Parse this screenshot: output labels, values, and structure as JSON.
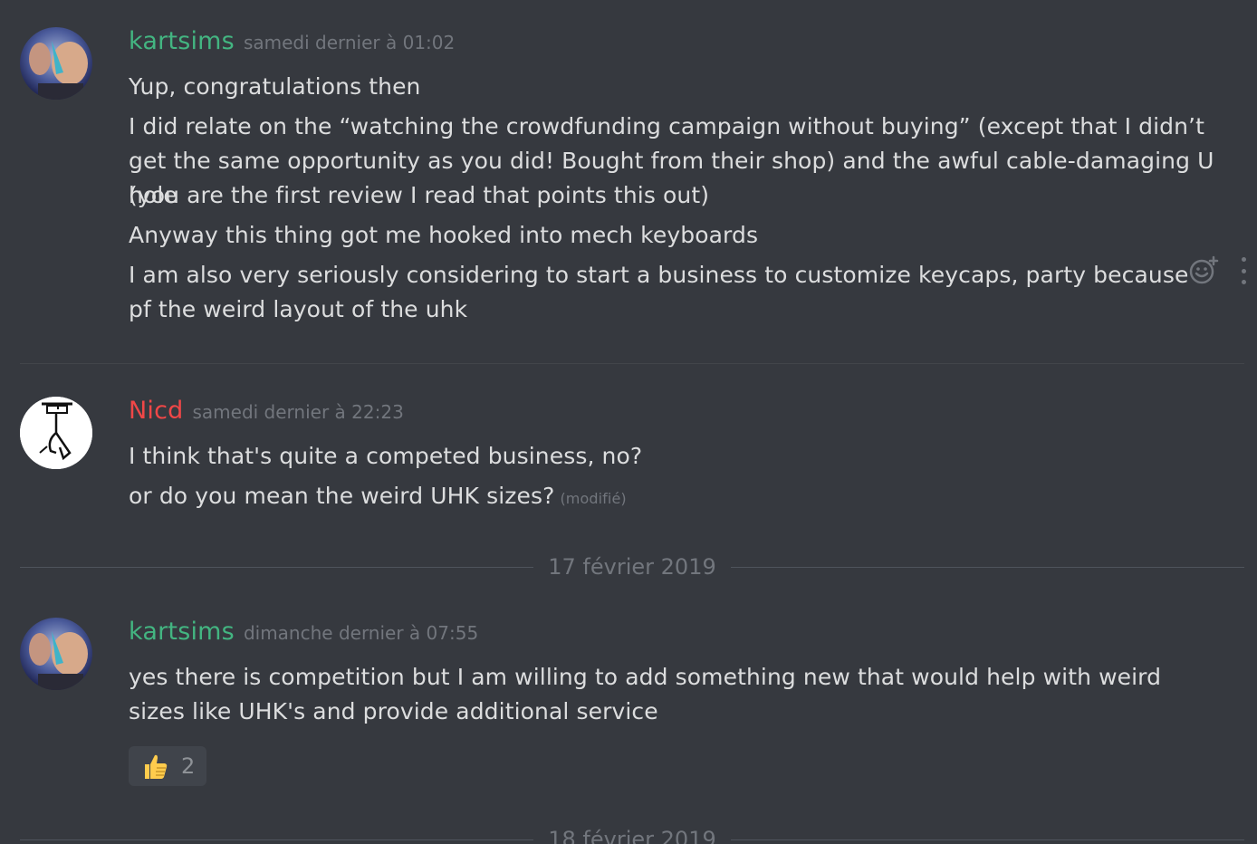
{
  "messages": [
    {
      "author": "kartsims",
      "author_color": "#43b581",
      "timestamp": "samedi dernier à 01:02",
      "lines": [
        "Yup, congratulations then",
        "I did relate on the “watching the crowdfunding campaign without buying” (except that I didn’t",
        "get the same opportunity as you did! Bought from their shop) and the awful cable-damaging U hole",
        "(you are the first review I read that points this out)",
        "Anyway this thing got me hooked into mech keyboards",
        "I am also very seriously considering to start a business to customize keycaps, party because",
        "pf the weird layout of the uhk"
      ]
    },
    {
      "author": "Nicd",
      "author_color": "#f04747",
      "timestamp": "samedi dernier à 22:23",
      "lines": [
        "I think that's quite a competed business, no?",
        "or do you mean the weird UHK sizes?"
      ],
      "edited_label": "(modifié)"
    },
    {
      "author": "kartsims",
      "author_color": "#43b581",
      "timestamp": "dimanche dernier à 07:55",
      "lines": [
        "yes there is competition but I am willing to add something new that would help with weird",
        "sizes like UHK's and provide additional service"
      ],
      "reaction": {
        "emoji": "thumbs-up-icon",
        "count": "2"
      }
    }
  ],
  "date_dividers": [
    "17 février 2019",
    "18 février 2019"
  ],
  "hover_actions": [
    "add-reaction-icon",
    "more-options-icon"
  ]
}
